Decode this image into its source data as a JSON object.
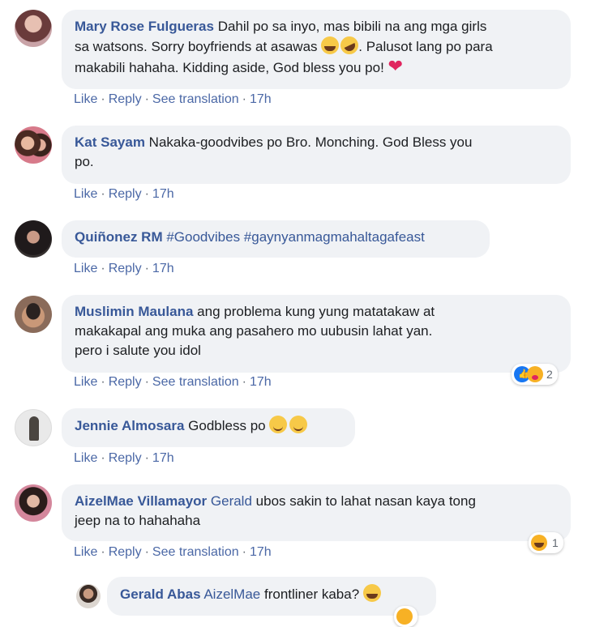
{
  "comments": [
    {
      "author": "Mary Rose Fulgueras",
      "text_line1": "Dahil po sa inyo, mas bibili na ang mga girls",
      "text_line2": "sa watsons. Sorry boyfriends at asawas",
      "text_line2_tail": ". Palusot lang po para",
      "text_line3": "makabili hahaha. Kidding aside, God bless you po!",
      "actions": {
        "like": "Like",
        "reply": "Reply",
        "translate": "See translation",
        "time": "17h"
      }
    },
    {
      "author": "Kat Sayam",
      "text_line1": "Nakaka-goodvibes po Bro. Monching. God Bless you",
      "text_line2": "po.",
      "actions": {
        "like": "Like",
        "reply": "Reply",
        "time": "17h"
      }
    },
    {
      "author": "Quiñonez RM",
      "text_line1": "#Goodvibes #gaynyanmagmahaltagafeast",
      "actions": {
        "like": "Like",
        "reply": "Reply",
        "time": "17h"
      }
    },
    {
      "author": "Muslimin Maulana",
      "text_line1": "ang problema kung yung matatakaw at",
      "text_line2": "makakapal ang muka ang pasahero mo uubusin lahat yan.",
      "text_line3": "pero i salute you idol",
      "actions": {
        "like": "Like",
        "reply": "Reply",
        "translate": "See translation",
        "time": "17h"
      },
      "reaction_count": "2"
    },
    {
      "author": "Jennie Almosara",
      "text_line1": "Godbless po",
      "actions": {
        "like": "Like",
        "reply": "Reply",
        "time": "17h"
      }
    },
    {
      "author": "AizelMae Villamayor",
      "mention": "Gerald",
      "text_line1": "ubos sakin to lahat nasan kaya tong",
      "text_line2": "jeep na to hahahaha",
      "actions": {
        "like": "Like",
        "reply": "Reply",
        "translate": "See translation",
        "time": "17h"
      },
      "reaction_count": "1"
    }
  ],
  "reply": {
    "author": "Gerald Abas",
    "mention": "AizelMae",
    "text": "frontliner kaba?"
  },
  "colors": {
    "name": "#385898",
    "bubble": "#f0f2f5",
    "meta": "#606770",
    "heart": "#e0245e",
    "like_blue": "#1877f2",
    "haha": "#f7b125"
  }
}
